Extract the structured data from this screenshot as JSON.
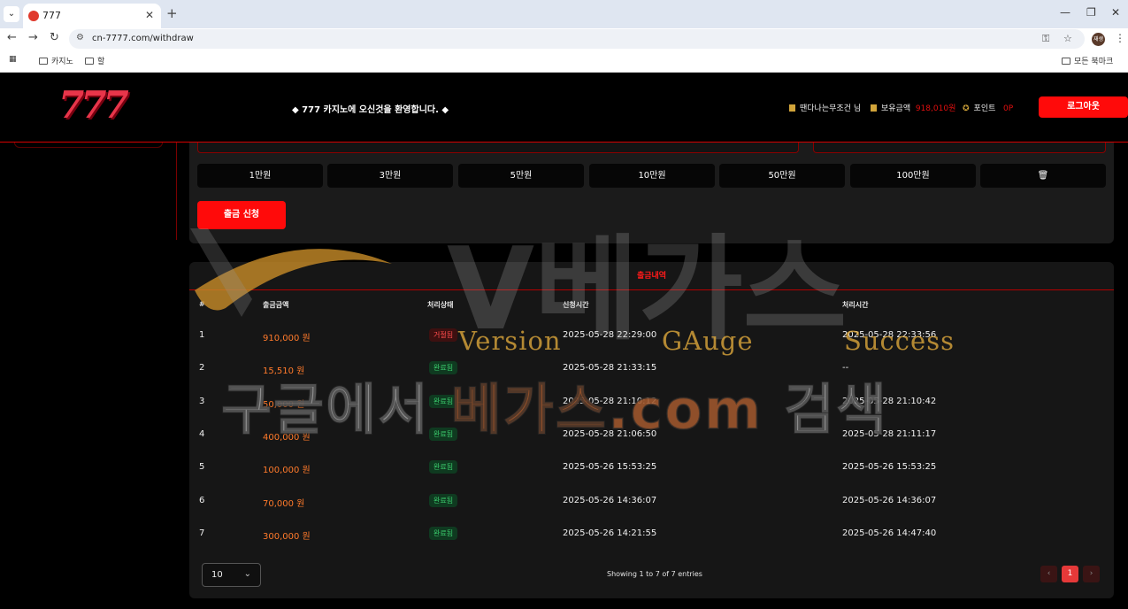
{
  "browser": {
    "tab_title": "777",
    "url": "cn-7777.com/withdraw",
    "profile_label": "재생",
    "bookmarks": [
      "카지노",
      "할"
    ],
    "all_bookmarks": "모든 북마크"
  },
  "header": {
    "logo_text": "777",
    "welcome": "◆ 777 카지노에 오신것을 환영합니다. ◆",
    "username": "땐다나는무조건 님",
    "balance_label": "보유금액",
    "balance_value": "918,010원",
    "points_label": "포인트",
    "points_value": "0P",
    "logout": "로그아웃"
  },
  "form": {
    "amount_buttons": [
      "1만원",
      "3만원",
      "5만원",
      "10만원",
      "50만원",
      "100만원"
    ],
    "clear_icon": "trash-icon",
    "submit": "출금 신청"
  },
  "history": {
    "title": "출금내역",
    "columns": [
      "#",
      "출금금액",
      "처리상태",
      "신청시간",
      "처리시간"
    ],
    "rows": [
      {
        "no": "1",
        "amount": "910,000 원",
        "status": "거절됨",
        "status_type": "rejected",
        "requested": "2025-05-28 22:29:00",
        "processed": "2025-05-28 22:33:56"
      },
      {
        "no": "2",
        "amount": "15,510 원",
        "status": "완료됨",
        "status_type": "done",
        "requested": "2025-05-28 21:33:15",
        "processed": "--"
      },
      {
        "no": "3",
        "amount": "50,000 원",
        "status": "완료됨",
        "status_type": "done",
        "requested": "2025-05-28 21:10:12",
        "processed": "2025-05-28 21:10:42"
      },
      {
        "no": "4",
        "amount": "400,000 원",
        "status": "완료됨",
        "status_type": "done",
        "requested": "2025-05-28 21:06:50",
        "processed": "2025-05-28 21:11:17"
      },
      {
        "no": "5",
        "amount": "100,000 원",
        "status": "완료됨",
        "status_type": "done",
        "requested": "2025-05-26 15:53:25",
        "processed": "2025-05-26 15:53:25"
      },
      {
        "no": "6",
        "amount": "70,000 원",
        "status": "완료됨",
        "status_type": "done",
        "requested": "2025-05-26 14:36:07",
        "processed": "2025-05-26 14:36:07"
      },
      {
        "no": "7",
        "amount": "300,000 원",
        "status": "완료됨",
        "status_type": "done",
        "requested": "2025-05-26 14:21:55",
        "processed": "2025-05-26 14:47:40"
      }
    ],
    "page_size": "10",
    "entries_text": "Showing 1 to 7 of 7 entries",
    "current_page": "1"
  },
  "watermark": {
    "vgas_text": "V베가스",
    "words": [
      "Version",
      "GAuge",
      "Success"
    ],
    "search_part1": "구글에서 ",
    "search_part2": "베가스.com",
    "search_part3": " 검색"
  },
  "colors": {
    "accent": "#ff0a0a",
    "amount": "#ff7a2b",
    "success": "#3ccf6e",
    "reject": "#ff4d4d"
  }
}
